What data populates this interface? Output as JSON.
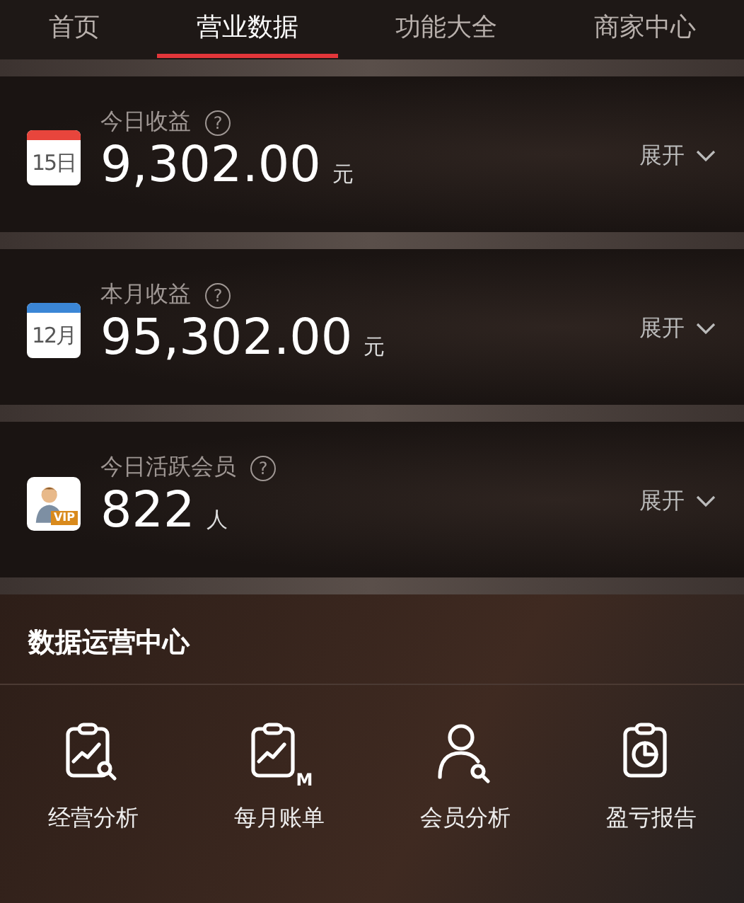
{
  "tabs": [
    {
      "label": "首页",
      "selected": false
    },
    {
      "label": "营业数据",
      "selected": true
    },
    {
      "label": "功能大全",
      "selected": false
    },
    {
      "label": "商家中心",
      "selected": false
    }
  ],
  "cards": [
    {
      "title": "今日收益",
      "help": "?",
      "kind": "calendar",
      "color": "#e8453c",
      "icon_text": "15日",
      "value": "9,302.00",
      "unit": "元",
      "action": "展开"
    },
    {
      "title": "本月收益",
      "help": "?",
      "kind": "calendar",
      "color": "#3b86d6",
      "icon_text": "12月",
      "value": "95,302.00",
      "unit": "元",
      "action": "展开"
    },
    {
      "title": "今日活跃会员",
      "help": "?",
      "kind": "vip",
      "icon_text": "VIP",
      "value": "822",
      "unit": "人",
      "action": "展开"
    }
  ],
  "section": {
    "title": "数据运营中心",
    "tools": [
      {
        "label": "经营分析",
        "kind": "chart-search"
      },
      {
        "label": "每月账单",
        "kind": "chart-month",
        "badge": "M"
      },
      {
        "label": "会员分析",
        "kind": "user-search"
      },
      {
        "label": "盈亏报告",
        "kind": "pie-report"
      }
    ]
  }
}
